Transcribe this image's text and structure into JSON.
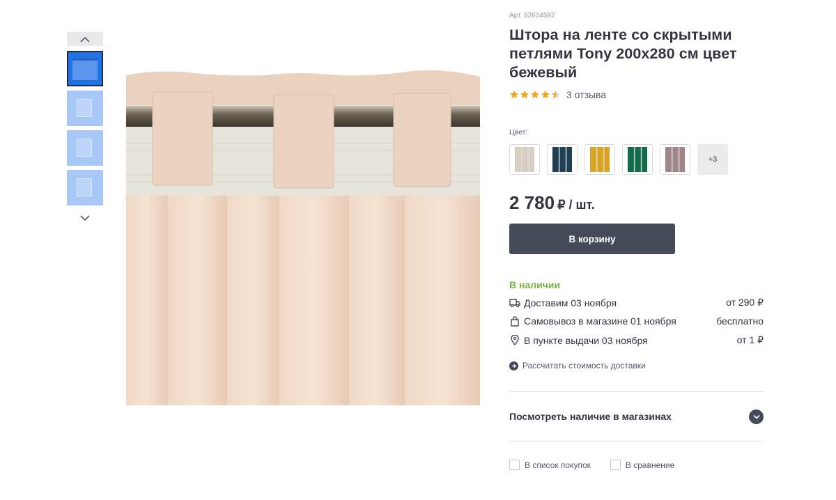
{
  "product": {
    "article": "Арт. 82604592",
    "title": "Штора на ленте со скрытыми петлями Tony 200x280 см цвет бежевый",
    "rating_value": 4.5,
    "rating_max": 5,
    "reviews_label": "3 отзыва",
    "star_color": "#f5a623"
  },
  "colors": {
    "label": "Цвет:",
    "swatches": [
      {
        "name": "beige",
        "hex": "#d9cfc0"
      },
      {
        "name": "dark-blue",
        "hex": "#1f3f55"
      },
      {
        "name": "mustard",
        "hex": "#d9a521"
      },
      {
        "name": "green",
        "hex": "#0f6b48"
      },
      {
        "name": "mauve",
        "hex": "#a08688"
      }
    ],
    "more_label": "+3"
  },
  "price": {
    "value": "2 780",
    "unit": "₽ / шт."
  },
  "cart_button": "В корзину",
  "availability": {
    "status": "В наличии",
    "status_color": "#7cb342",
    "options": [
      {
        "icon": "truck-icon",
        "label": "Доставим 03 ноября",
        "price": "от 290 ₽"
      },
      {
        "icon": "bag-icon",
        "label": "Самовывоз в магазине 01 ноября",
        "price": "бесплатно"
      },
      {
        "icon": "location-pin-icon",
        "label": "В пункте выдачи 03 ноября",
        "price": "от 1 ₽"
      }
    ],
    "calc_link": "Рассчитать стоимость доставки"
  },
  "stores": {
    "label": "Посмотреть наличие в магазинах"
  },
  "actions": {
    "shopping_list": "В список покупок",
    "compare": "В сравнение"
  },
  "gallery": {
    "selected_index": 0,
    "thumb_count": 4,
    "accent_color": "#1e73e8"
  }
}
